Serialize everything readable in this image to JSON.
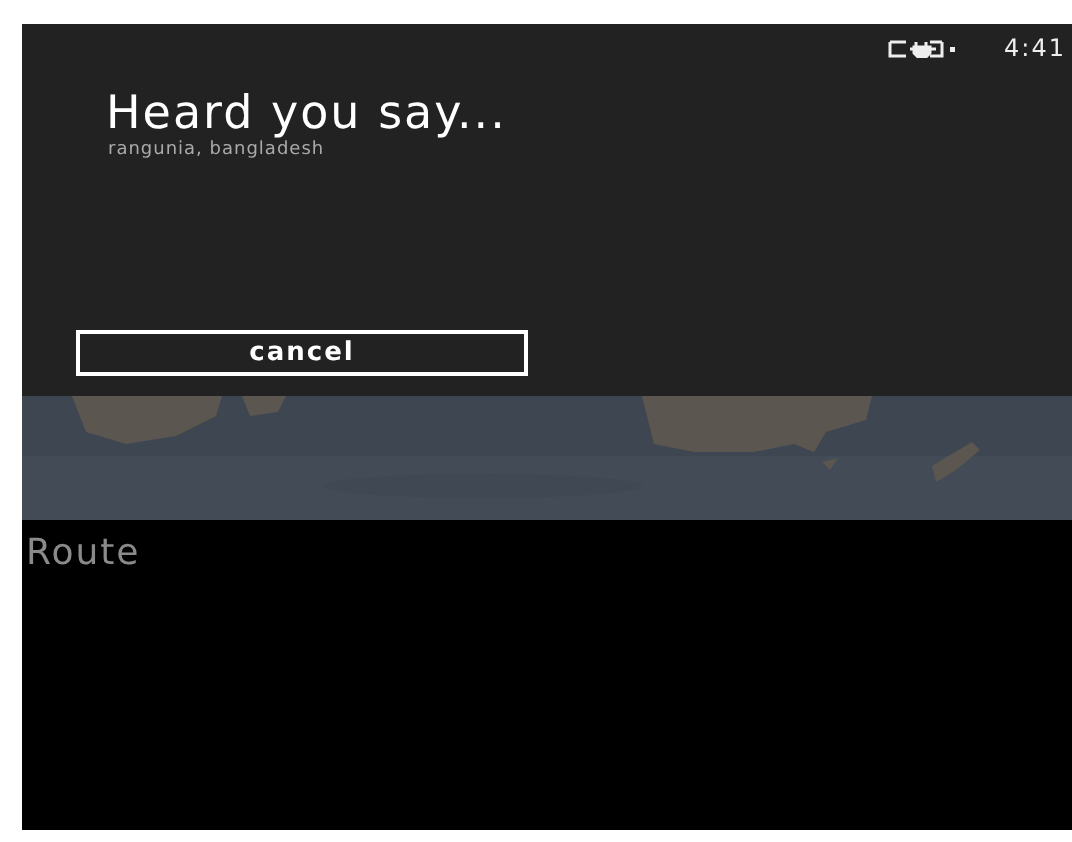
{
  "status_bar": {
    "time": "4:41"
  },
  "dialog": {
    "title": "Heard you say...",
    "subtitle": "rangunia, bangladesh",
    "buttons": [
      "cancel"
    ]
  },
  "panel": {
    "title": "Route"
  }
}
